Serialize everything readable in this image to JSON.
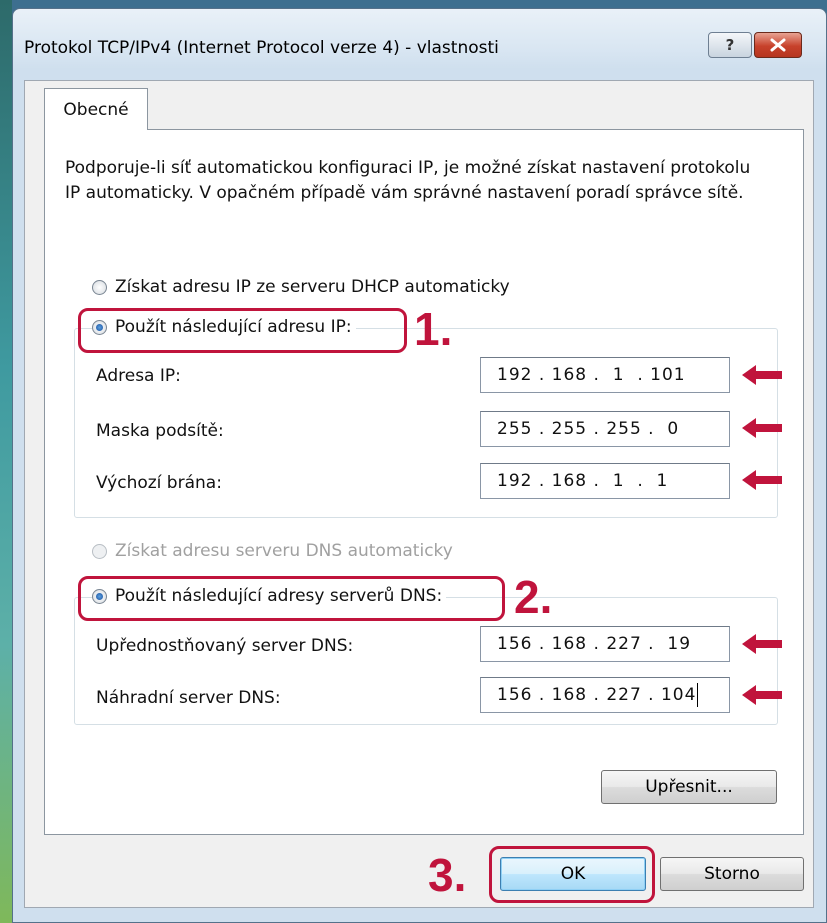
{
  "window": {
    "title": "Protokol TCP/IPv4 (Internet Protocol verze 4) - vlastnosti",
    "help_label": "?",
    "close_label": "X"
  },
  "tabs": [
    {
      "label": "Obecné",
      "active": true
    }
  ],
  "description": "Podporuje-li síť automatickou konfiguraci IP, je možné získat nastavení protokolu IP automaticky. V opačném případě vám správné nastavení poradí správce sítě.",
  "ip_section": {
    "auto_option": {
      "label": "Získat adresu IP ze serveru DHCP automaticky",
      "selected": false,
      "enabled": true
    },
    "manual_option": {
      "label": "Použít následující adresu IP:",
      "selected": true,
      "enabled": true
    },
    "fields": [
      {
        "label": "Adresa IP:",
        "value": "192 . 168 .  1  . 101"
      },
      {
        "label": "Maska podsítě:",
        "value": "255 . 255 . 255 .  0"
      },
      {
        "label": "Výchozí brána:",
        "value": "192 . 168 .  1  .  1"
      }
    ]
  },
  "dns_section": {
    "auto_option": {
      "label": "Získat adresu serveru DNS automaticky",
      "selected": false,
      "enabled": false
    },
    "manual_option": {
      "label": "Použít následující adresy serverů DNS:",
      "selected": true,
      "enabled": true
    },
    "fields": [
      {
        "label": "Upřednostňovaný server DNS:",
        "value": "156 . 168 . 227 .  19"
      },
      {
        "label": "Náhradní server DNS:",
        "value": "156 . 168 . 227 . 104"
      }
    ]
  },
  "buttons": {
    "advanced": "Upřesnit...",
    "ok": "OK",
    "cancel": "Storno"
  },
  "annotations": {
    "step1": "1.",
    "step2": "2.",
    "step3": "3.",
    "color": "#c0143c"
  }
}
